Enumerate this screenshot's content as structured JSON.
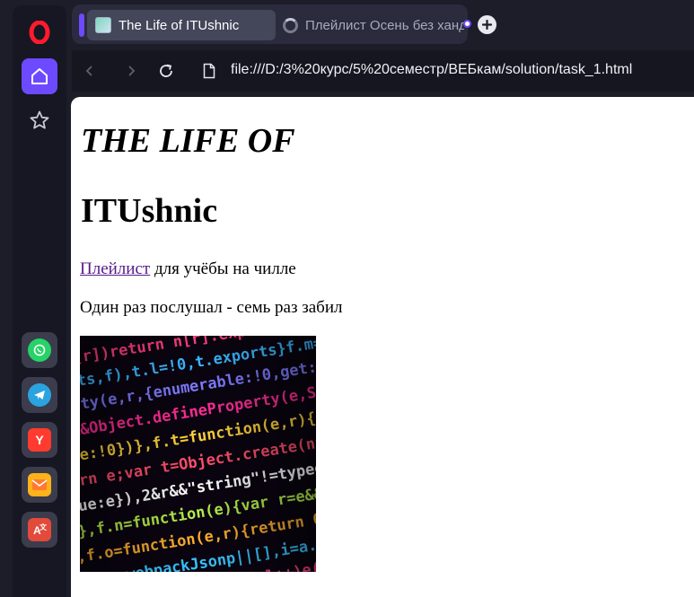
{
  "tabs": [
    {
      "title": "The Life of ITUshnic",
      "active": true
    },
    {
      "title": "Плейлист Осень без хандры",
      "active": false
    }
  ],
  "address": {
    "url": "file:///D:/3%20курс/5%20семестр/ВЕБкам/solution/task_1.html"
  },
  "sidebar": {
    "top": [
      "opera-logo",
      "home-icon",
      "star-icon"
    ],
    "apps": [
      {
        "name": "whatsapp",
        "color": "#25d366"
      },
      {
        "name": "telegram",
        "color": "#2aa3df"
      },
      {
        "name": "yandex",
        "color": "#ff3b2f",
        "glyph": "Y"
      },
      {
        "name": "mail",
        "color": "#ffb21a"
      },
      {
        "name": "translate",
        "color": "#e24a3b"
      }
    ]
  },
  "page": {
    "heading1": "THE LIFE OF",
    "heading2": "ITUshnic",
    "link_text": "Плейлист",
    "line1_rest": " для учёбы на чилле",
    "line2": "Один раз послушал - семь раз забил"
  },
  "colors": {
    "accent": "#6d4aff",
    "link": "#551a8b"
  }
}
